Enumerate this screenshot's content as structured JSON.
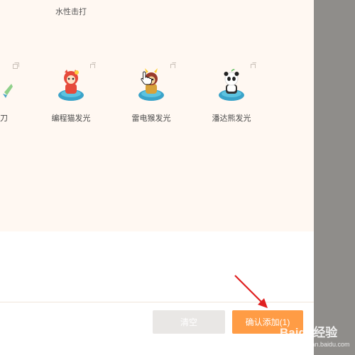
{
  "dialog": {
    "top_label": "水性击打",
    "partial_label": "刀",
    "items": [
      {
        "label": "编程猫发光",
        "icon": "cat-sprite-icon"
      },
      {
        "label": "雷电猴发光",
        "icon": "monkey-sprite-icon"
      },
      {
        "label": "潘达熊发光",
        "icon": "panda-sprite-icon"
      }
    ],
    "buttons": {
      "clear": "清空",
      "confirm": "确认添加(1)"
    }
  },
  "watermark": {
    "brand": "Baidu经验",
    "url": "jingyan.baidu.com"
  },
  "colors": {
    "confirm": "#ff9c45",
    "clear": "#e9e7e5",
    "upper_bg": "#fff8f2",
    "arrow": "#e02020"
  }
}
